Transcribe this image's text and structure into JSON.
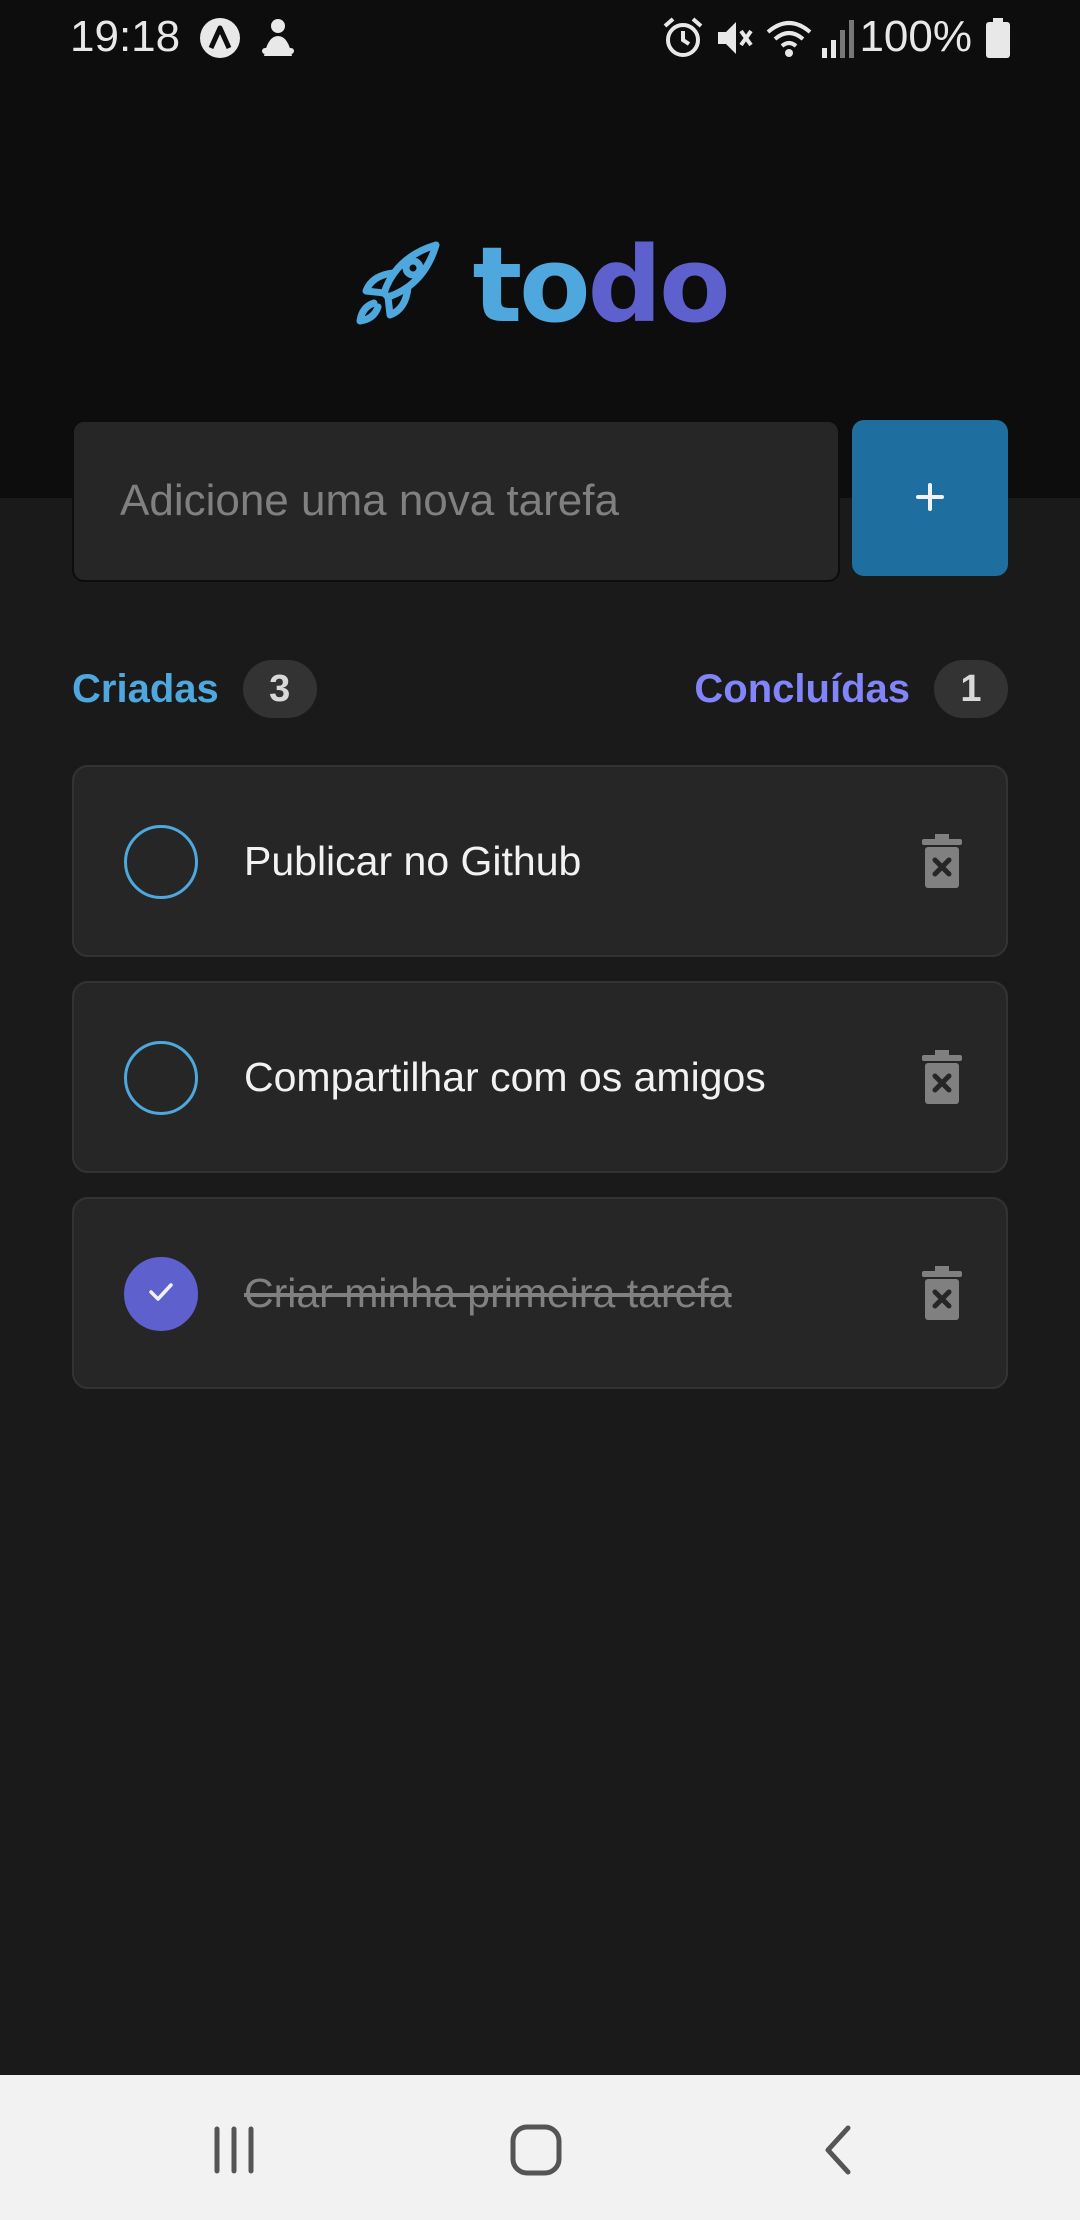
{
  "status_bar": {
    "time": "19:18",
    "battery": "100%",
    "icons": [
      "app-a-icon",
      "notification-icon",
      "alarm-icon",
      "mute-icon",
      "wifi-icon",
      "signal-icon",
      "battery-icon"
    ]
  },
  "app": {
    "logo_icon": "rocket-icon",
    "logo_part1": "to",
    "logo_part2": "do",
    "colors": {
      "blue": "#4ea8de",
      "purple": "#5e60ce",
      "button": "#1e6f9f"
    }
  },
  "new_task": {
    "placeholder": "Adicione uma nova tarefa",
    "value": "",
    "add_icon": "plus-icon",
    "add_label": "+"
  },
  "counters": {
    "created_label": "Criadas",
    "created_count": "3",
    "done_label": "Concluídas",
    "done_count": "1"
  },
  "tasks": [
    {
      "text": "Publicar no Github",
      "done": false
    },
    {
      "text": "Compartilhar com os amigos",
      "done": false
    },
    {
      "text": "Criar minha primeira tarefa",
      "done": true
    }
  ],
  "nav_bar": {
    "icons": [
      "recent-apps-icon",
      "home-icon",
      "back-icon"
    ]
  }
}
